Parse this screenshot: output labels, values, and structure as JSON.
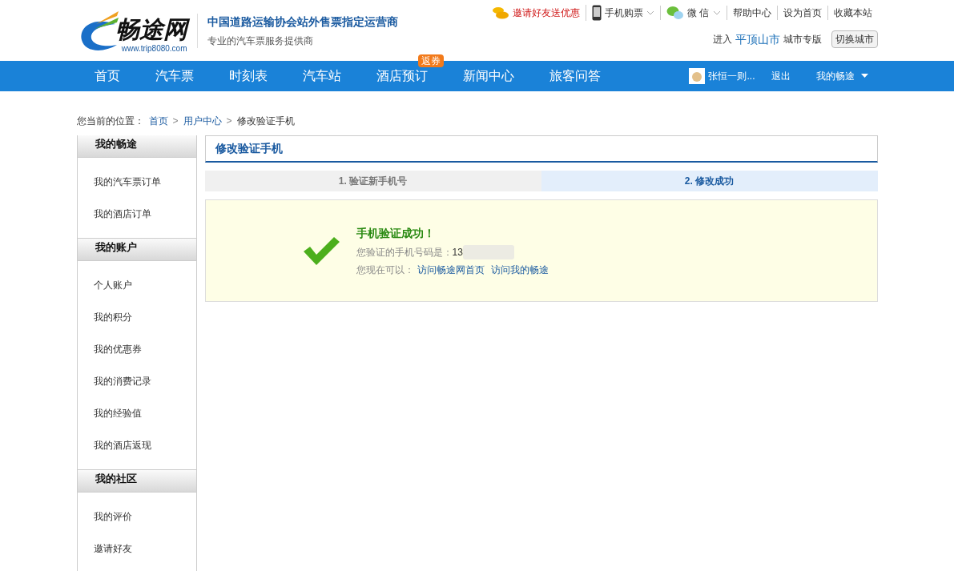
{
  "logo": {
    "name": "畅途网",
    "url": "www.trip8080.com"
  },
  "slogan": {
    "title": "中国道路运输协会站外售票指定运营商",
    "subtitle": "专业的汽车票服务提供商"
  },
  "top_links": [
    {
      "kind": "invite",
      "label": "邀请好友送优惠"
    },
    {
      "kind": "phone",
      "label": "手机购票"
    },
    {
      "kind": "wechat",
      "label": "微 信"
    },
    {
      "kind": "plain",
      "label": "帮助中心"
    },
    {
      "kind": "plain",
      "label": "设为首页"
    },
    {
      "kind": "plain",
      "label": "收藏本站"
    }
  ],
  "city": {
    "prefix": "进入",
    "name": "平顶山市",
    "suffix": "城市专版",
    "button": "切换城市"
  },
  "nav": [
    {
      "label": "首页"
    },
    {
      "label": "汽车票"
    },
    {
      "label": "时刻表"
    },
    {
      "label": "汽车站"
    },
    {
      "label": "酒店预订",
      "badge": "返券"
    },
    {
      "label": "新闻中心"
    },
    {
      "label": "旅客问答"
    }
  ],
  "user": {
    "name": "张恒一则...",
    "logout": "退出",
    "menu": "我的畅途"
  },
  "breadcrumb": {
    "prefix": "您当前的位置：",
    "links": [
      "首页",
      "用户中心"
    ],
    "current": "修改验证手机",
    "separator": ">"
  },
  "sidebar": [
    {
      "title": "我的畅途",
      "items": [
        "我的汽车票订单",
        "我的酒店订单"
      ]
    },
    {
      "title": "我的账户",
      "items": [
        "个人账户",
        "我的积分",
        "我的优惠券",
        "我的消费记录",
        "我的经验值",
        "我的酒店返现"
      ]
    },
    {
      "title": "我的社区",
      "items": [
        "我的评价",
        "邀请好友"
      ]
    }
  ],
  "panel_title": "修改验证手机",
  "steps": [
    {
      "label": "1. 验证新手机号",
      "selected": false
    },
    {
      "label": "2. 修改成功",
      "selected": true
    }
  ],
  "result": {
    "title": "手机验证成功！",
    "phone_label": "您验证的手机号码是：",
    "phone": "13",
    "next_label": "您现在可以：",
    "links": [
      "访问畅途网首页",
      "访问我的畅途"
    ]
  }
}
